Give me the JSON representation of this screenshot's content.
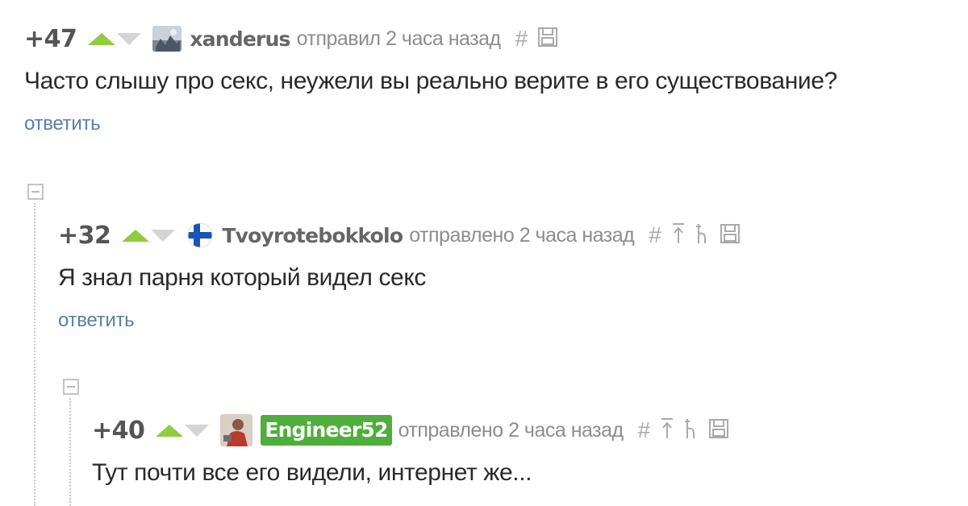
{
  "comments": [
    {
      "rating": "+47",
      "username": "xanderus",
      "meta": "отправил 2 часа назад",
      "text": "Часто слышу про секс, неужели вы реально верите в его существование?",
      "reply": "ответить",
      "icons": [
        "hash-icon",
        "save-icon"
      ]
    },
    {
      "rating": "+32",
      "username": "Tvoyrotebokkolo",
      "meta": "отправлено 2 часа назад",
      "text": "Я знал парня который видел секс",
      "reply": "ответить",
      "icons": [
        "hash-icon",
        "go-to-parent-icon",
        "go-to-root-icon",
        "save-icon"
      ]
    },
    {
      "rating": "+40",
      "username": "Engineer52",
      "meta": "отправлено 2 часа назад",
      "text": "Тут почти все его видели, интернет же...",
      "icons": [
        "hash-icon",
        "go-to-parent-icon",
        "go-to-root-icon",
        "save-icon"
      ]
    }
  ],
  "colors": {
    "upvote": "#8fcc3e",
    "downvote": "#d4d4d4",
    "reply_link": "#5b7fa8",
    "badge": "#4fae3c"
  }
}
